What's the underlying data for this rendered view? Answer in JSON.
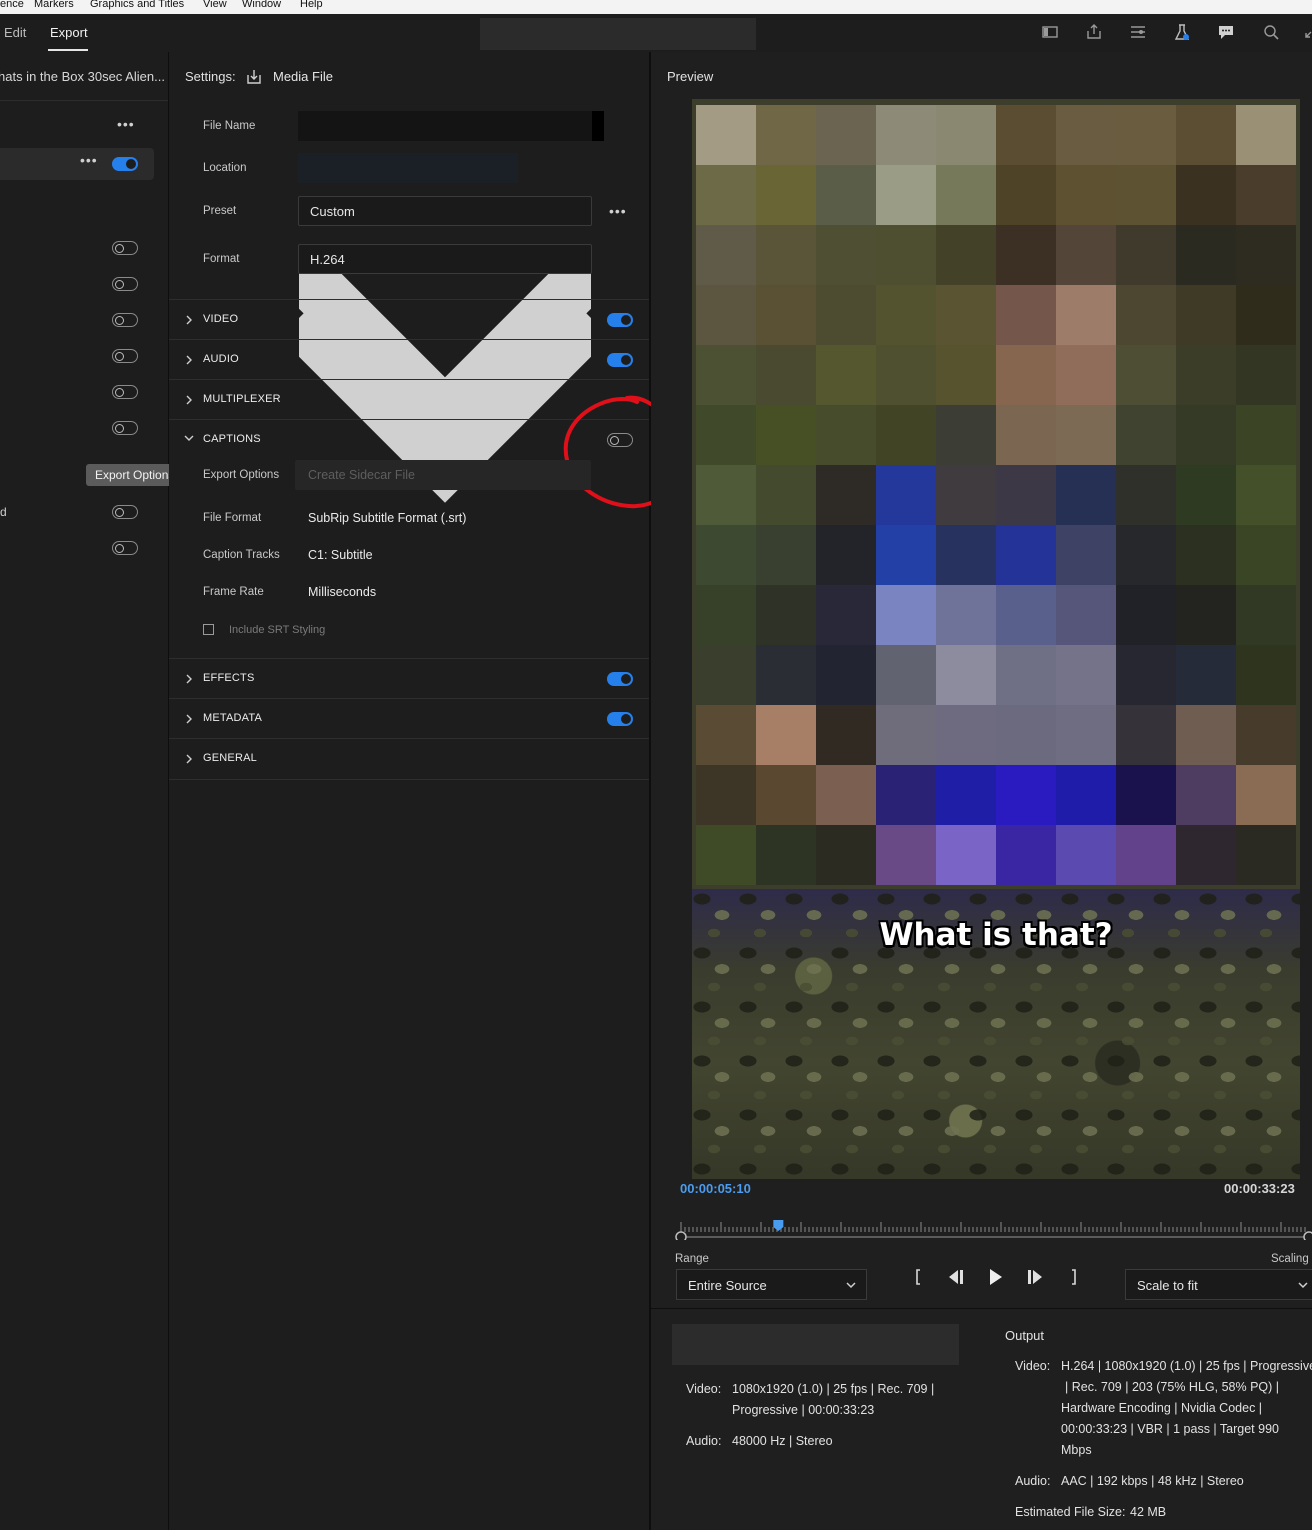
{
  "menu": [
    "ence",
    "Markers",
    "Graphics and Titles",
    "View",
    "Window",
    "Help"
  ],
  "workspace": {
    "tabs": [
      "Edit",
      "Export"
    ],
    "active": "Export"
  },
  "left": {
    "sequence_name": "hats in the Box 30sec Alien...",
    "tooltip": "Export Options",
    "partial_label": "d"
  },
  "settings": {
    "header_label": "Settings:",
    "header_value": "Media File",
    "file_name_label": "File Name",
    "location_label": "Location",
    "preset_label": "Preset",
    "preset_value": "Custom",
    "format_label": "Format",
    "format_value": "H.264",
    "sections": {
      "video": "VIDEO",
      "audio": "AUDIO",
      "multiplexer": "MULTIPLEXER",
      "captions": "CAPTIONS",
      "effects": "EFFECTS",
      "metadata": "METADATA",
      "general": "GENERAL"
    },
    "captions": {
      "export_options_label": "Export Options",
      "export_options_value": "Create Sidecar File",
      "file_format_label": "File Format",
      "file_format_value": "SubRip Subtitle Format (.srt)",
      "caption_tracks_label": "Caption Tracks",
      "caption_tracks_value": "C1: Subtitle",
      "frame_rate_label": "Frame Rate",
      "frame_rate_value": "Milliseconds",
      "include_srt_label": "Include SRT Styling",
      "enabled": false
    },
    "toggles": {
      "video": true,
      "audio": true,
      "effects": true,
      "metadata": true
    }
  },
  "preview": {
    "title": "Preview",
    "caption_text": "What is that?",
    "current_time": "00:00:05:10",
    "duration": "00:00:33:23",
    "playhead_fraction": 0.155,
    "range_label": "Range",
    "range_value": "Entire Source",
    "scaling_label": "Scaling",
    "scaling_value": "Scale to fit"
  },
  "source_info": {
    "video_key": "Video:",
    "video_line1": "1080x1920 (1.0) | 25 fps | Rec. 709 |",
    "video_line2": "Progressive | 00:00:33:23",
    "audio_key": "Audio:",
    "audio_line": "48000 Hz | Stereo"
  },
  "output": {
    "title": "Output",
    "video_key": "Video:",
    "video_lines": [
      "H.264 | 1080x1920 (1.0) | 25 fps | Progressive",
      "| Rec. 709 | 203 (75% HLG, 58% PQ) |",
      "Hardware Encoding | Nvidia Codec |",
      "00:00:33:23 | VBR | 1 pass | Target 990",
      "Mbps"
    ],
    "audio_key": "Audio:",
    "audio_line": "AAC | 192 kbps | 48 kHz | Stereo",
    "size_label": "Estimated File Size:",
    "size_value": "42 MB"
  },
  "colors": {
    "accent": "#2680eb",
    "timecode_blue": "#4a9cf0",
    "annotation_red": "#e0101a"
  },
  "icons": [
    "media-file-export-icon",
    "chevron-down-icon",
    "more-icon",
    "chevron-right-icon",
    "play-icon",
    "step-back-icon",
    "step-forward-icon",
    "mark-in-icon",
    "mark-out-icon",
    "toolbar-icons"
  ]
}
